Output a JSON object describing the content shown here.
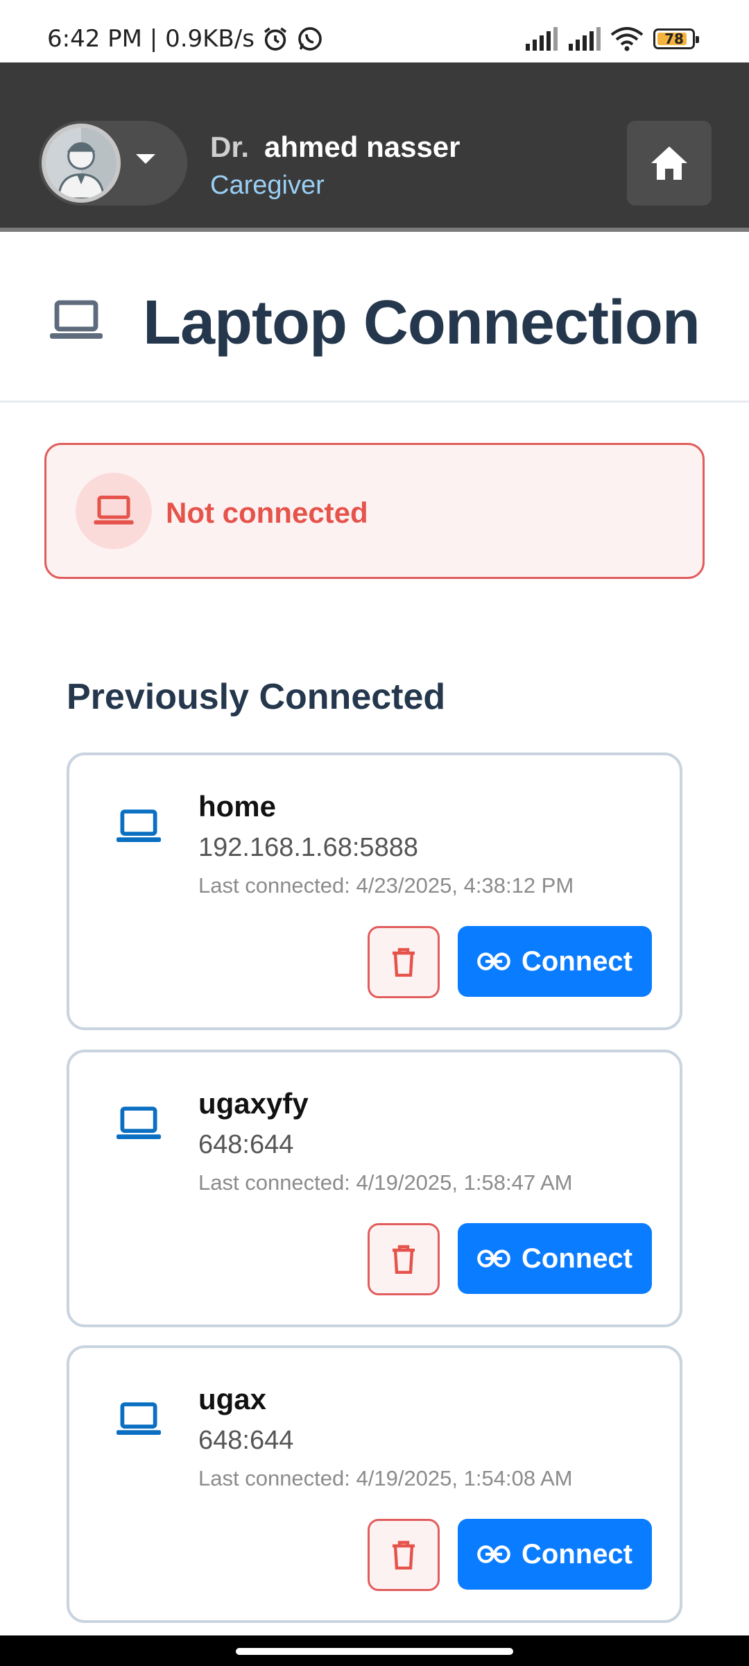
{
  "status_bar": {
    "time": "6:42 PM | 0.9KB/s",
    "battery": "78",
    "battery_level": 0.78
  },
  "header": {
    "title_prefix": "Dr.",
    "user_name": "ahmed nasser",
    "role": "Caregiver",
    "icons": {
      "avatar": "user-avatar",
      "dropdown": "chevron-down-icon",
      "home": "home-icon"
    }
  },
  "page": {
    "title": "Laptop Connection",
    "icon": "laptop-icon"
  },
  "connection_status": {
    "text": "Not connected",
    "color": "#e5534b"
  },
  "previous": {
    "section_title": "Previously Connected",
    "devices": [
      {
        "name": "home",
        "address": "192.168.1.68:5888",
        "last_connected": "Last connected: 4/23/2025, 4:38:12 PM",
        "connect_label": "Connect"
      },
      {
        "name": "ugaxyfy",
        "address": "648:644",
        "last_connected": "Last connected: 4/19/2025, 1:58:47 AM",
        "connect_label": "Connect"
      },
      {
        "name": "ugax",
        "address": "648:644",
        "last_connected": "Last connected: 4/19/2025, 1:54:08 AM",
        "connect_label": "Connect"
      }
    ]
  },
  "colors": {
    "accent": "#0a7cff",
    "danger": "#e25c5c",
    "header_bg": "#3a3a3a",
    "title": "#24374d"
  }
}
